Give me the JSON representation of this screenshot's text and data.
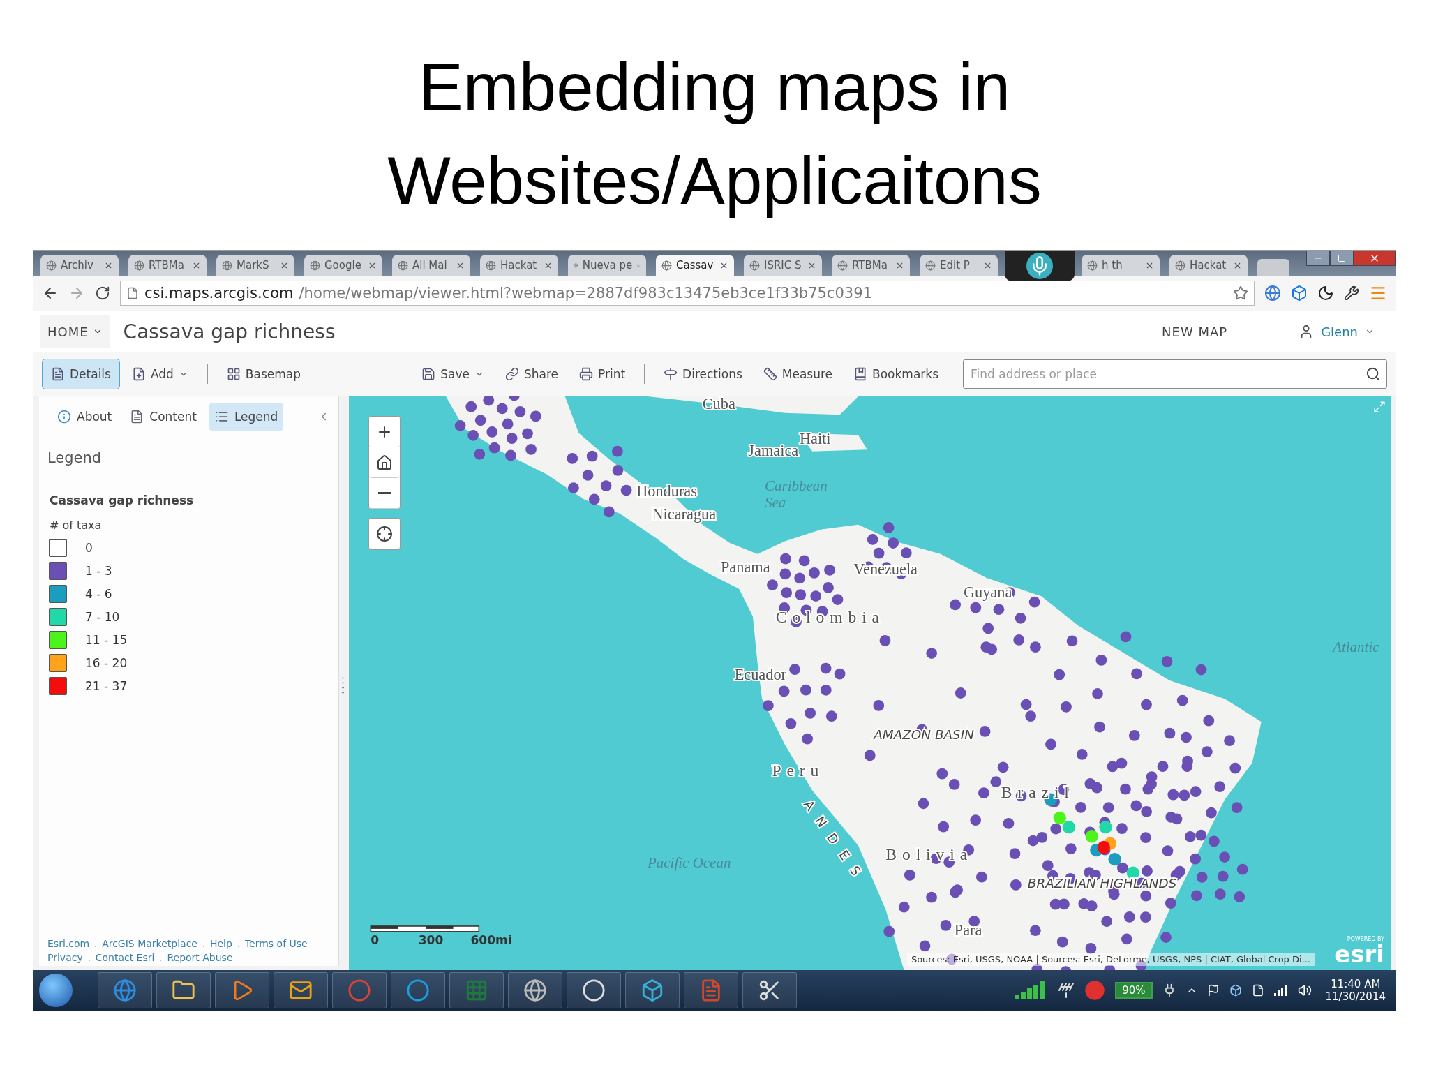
{
  "slide": {
    "title_lines": [
      "Embedding maps in",
      "Websites/Applicaitons"
    ]
  },
  "browser": {
    "tabs": [
      {
        "title": "Archiv",
        "selected": false
      },
      {
        "title": "RTBMa",
        "selected": false
      },
      {
        "title": "MarkS",
        "selected": false
      },
      {
        "title": "Google",
        "selected": false
      },
      {
        "title": "All Mai",
        "selected": false
      },
      {
        "title": "Hackat",
        "selected": false
      },
      {
        "title": "Nueva pe",
        "selected": false
      },
      {
        "title": "Cassav",
        "selected": true
      },
      {
        "title": "ISRIC S",
        "selected": false
      },
      {
        "title": "RTBMa",
        "selected": false
      },
      {
        "title": "Edit P",
        "selected": false
      },
      {
        "title": "h th",
        "selected": false
      },
      {
        "title": "Hackat",
        "selected": false
      }
    ],
    "address": {
      "host": "csi.maps.arcgis.com",
      "path": "/home/webmap/viewer.html?webmap=2887df983c13475eb3ce1f33b75c0391"
    }
  },
  "header": {
    "home": "HOME",
    "title": "Cassava gap richness",
    "new_map": "NEW MAP",
    "user": "Glenn"
  },
  "toolbar": {
    "left_groups": [
      [
        {
          "label": "Details",
          "selected": true,
          "dropdown": false
        },
        {
          "label": "Add",
          "selected": false,
          "dropdown": true
        }
      ],
      [
        {
          "label": "Basemap",
          "selected": false,
          "dropdown": false
        }
      ]
    ],
    "right_groups": [
      [
        {
          "label": "Save",
          "selected": false,
          "dropdown": true
        },
        {
          "label": "Share",
          "selected": false,
          "dropdown": false
        },
        {
          "label": "Print",
          "selected": false,
          "dropdown": false
        }
      ],
      [
        {
          "label": "Directions",
          "selected": false,
          "dropdown": false
        },
        {
          "label": "Measure",
          "selected": false,
          "dropdown": false
        },
        {
          "label": "Bookmarks",
          "selected": false,
          "dropdown": false
        }
      ]
    ],
    "search": {
      "placeholder": "Find address or place"
    }
  },
  "panel": {
    "tabs": [
      {
        "label": "About",
        "selected": false
      },
      {
        "label": "Content",
        "selected": false
      },
      {
        "label": "Legend",
        "selected": true
      }
    ],
    "heading": "Legend",
    "layer": "Cassava gap richness",
    "field": "# of taxa",
    "classes": [
      {
        "label": "0",
        "color": "#ffffff"
      },
      {
        "label": "1 - 3",
        "color": "#6a4fb4"
      },
      {
        "label": "4 - 6",
        "color": "#1c9cbf"
      },
      {
        "label": "7 - 10",
        "color": "#21d9a8"
      },
      {
        "label": "11 - 15",
        "color": "#4cf41c"
      },
      {
        "label": "16 - 20",
        "color": "#ffa31a"
      },
      {
        "label": "21 - 37",
        "color": "#f40d0d"
      }
    ],
    "footer_links": [
      [
        "Esri.com",
        "ArcGIS Marketplace",
        "Help",
        "Terms of Use"
      ],
      [
        "Privacy",
        "Contact Esri",
        "Report Abuse"
      ]
    ]
  },
  "map": {
    "labels": [
      {
        "text": "Cuba",
        "kind": "country"
      },
      {
        "text": "Haiti",
        "kind": "country"
      },
      {
        "text": "Jamaica",
        "kind": "country"
      },
      {
        "text": "Caribbean",
        "kind": "water"
      },
      {
        "text": "Sea",
        "kind": "water"
      },
      {
        "text": "Honduras",
        "kind": "country"
      },
      {
        "text": "Nicaragua",
        "kind": "country"
      },
      {
        "text": "Panama",
        "kind": "country"
      },
      {
        "text": "Venezuela",
        "kind": "country"
      },
      {
        "text": "Guyana",
        "kind": "country"
      },
      {
        "text": "Colombia",
        "kind": "spaced"
      },
      {
        "text": "Atlantic",
        "kind": "water"
      },
      {
        "text": "Ecuador",
        "kind": "country"
      },
      {
        "text": "AMAZON BASIN",
        "kind": "region"
      },
      {
        "text": "Peru",
        "kind": "spaced"
      },
      {
        "text": "Brazil",
        "kind": "spaced"
      },
      {
        "text": "ANDES",
        "kind": "ridge"
      },
      {
        "text": "Bolivia",
        "kind": "spaced"
      },
      {
        "text": "Pacific Ocean",
        "kind": "water"
      },
      {
        "text": "BRAZILIAN HIGHLANDS",
        "kind": "region"
      },
      {
        "text": "Para",
        "kind": "country"
      }
    ],
    "scale_labels": [
      "0",
      "300",
      "600mi"
    ],
    "attribution": "Sources: Esri, USGS, NOAA | Sources: Esri, DeLorme, USGS, NPS | CIAT, Global Crop Di...",
    "logo": {
      "caption": "POWERED BY",
      "name": "esri"
    }
  },
  "taskbar": {
    "battery": "90%",
    "time": "11:40 AM",
    "date": "11/30/2014"
  }
}
